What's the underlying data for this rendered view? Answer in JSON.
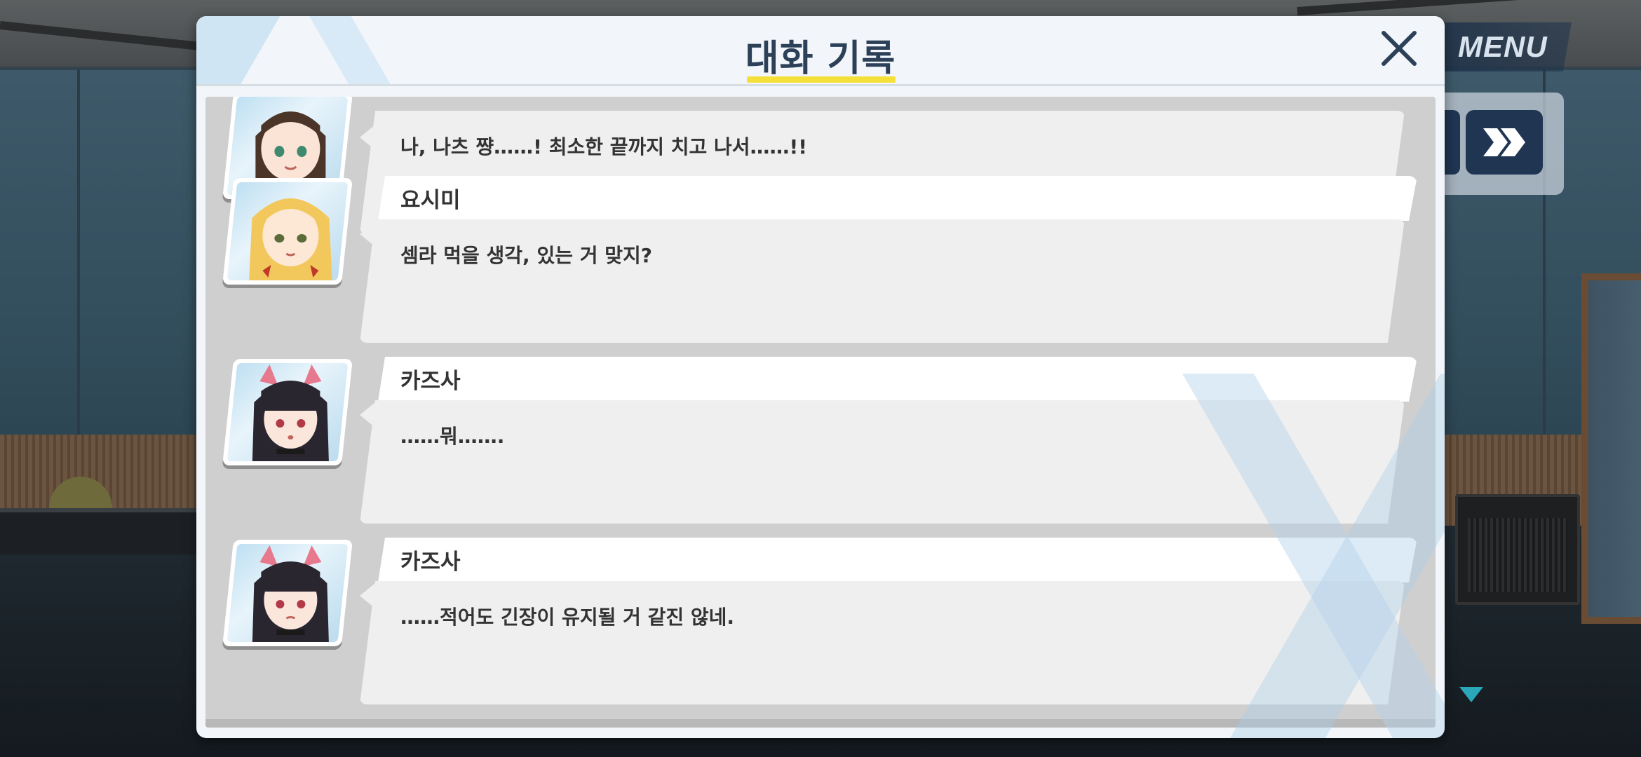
{
  "header": {
    "title": "대화 기록"
  },
  "controls": {
    "menu_label": "MENU"
  },
  "log": {
    "entries": [
      {
        "name": "",
        "text": "나, 나츠 쨩……! 최소한 끝까지 치고 나서……!!",
        "portrait": "brown-hair-girl"
      },
      {
        "name": "요시미",
        "text": "셈라 먹을 생각, 있는 거 맞지?",
        "portrait": "blonde-girl"
      },
      {
        "name": "카즈사",
        "text": "……뭐…….",
        "portrait": "cat-ear-girl"
      },
      {
        "name": "카즈사",
        "text": "……적어도 긴장이 유지될 거 같진 않네.",
        "portrait": "cat-ear-girl"
      }
    ]
  },
  "colors": {
    "title": "#2c4058",
    "title_underline": "#f5e03a",
    "accent_button": "#1f3552",
    "scroll_indicator": "#2aa7b8"
  }
}
